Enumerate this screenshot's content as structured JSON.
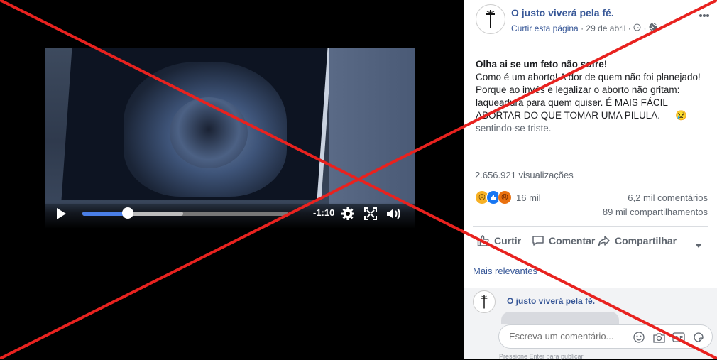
{
  "video": {
    "time_remaining": "-1:10",
    "progress_fraction": 0.22,
    "buffered_fraction": 0.49
  },
  "post": {
    "page_name": "O justo viverá pela fé.",
    "follow_label": "Curtir esta página",
    "separator": "·",
    "date": "29 de abril",
    "headline": "Olha ai se um feto não sofre!",
    "body": "Como é um aborto! A dor de quem não foi planejado! Porque ao invés e legalizar o aborto não gritam: laqueadura para quem quiser. É MAIS FÁCIL ABORTAR DO QUE TOMAR UMA PILULA. — ",
    "feeling_emoji": "😢",
    "feeling": "sentindo-se triste.",
    "views": "2.656.921 visualizações",
    "reactions_count": "16 mil",
    "comments_count": "6,2 mil comentários",
    "shares_count": "89 mil compartilhamentos",
    "reaction_colors": {
      "sad": "#f7b125",
      "like": "#1877f2",
      "angry": "#e9710f"
    }
  },
  "actions": {
    "like": "Curtir",
    "comment": "Comentar",
    "share": "Compartilhar"
  },
  "comments": {
    "sort_label": "Mais relevantes",
    "commenter_name": "O justo viverá pela fé.",
    "input_placeholder": "Escreva um comentário...",
    "hint": "Pressione Enter para publicar."
  },
  "overlay": {
    "cross_color": "#e8221f"
  }
}
